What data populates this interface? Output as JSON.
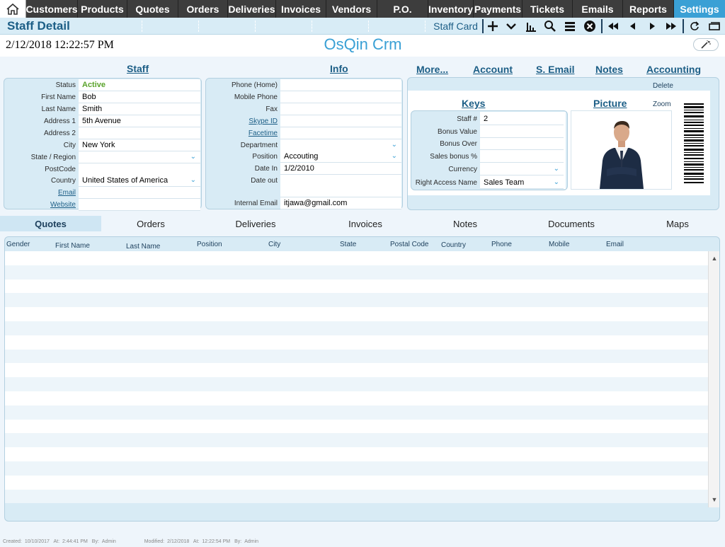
{
  "nav": {
    "home_icon": "home-icon",
    "items": [
      "Customers",
      "Products",
      "Quotes",
      "Orders",
      "Deliveries",
      "Invoices",
      "Vendors",
      "P.O.",
      "Inventory",
      "Payments",
      "Tickets",
      "Emails",
      "Reports",
      "Settings"
    ],
    "active": "Settings"
  },
  "toolbar": {
    "page_title": "Staff Detail",
    "staff_card_label": "Staff Card",
    "icons": [
      "add-icon",
      "chevron-down-icon",
      "chart-icon",
      "search-icon",
      "list-icon",
      "close-circle-icon",
      "first-record-icon",
      "previous-record-icon",
      "next-record-icon",
      "last-record-icon",
      "refresh-icon",
      "window-icon"
    ]
  },
  "header": {
    "datetime": "2/12/2018 12:22:57 PM",
    "app_title": "OsQin Crm",
    "magic_icon": "magic-wand-icon"
  },
  "sections": {
    "staff": "Staff",
    "info": "Info",
    "more": "More...",
    "account": "Account",
    "s_email": "S. Email",
    "notes": "Notes",
    "accounting": "Accounting"
  },
  "staff": {
    "status_label": "Status",
    "status": "Active",
    "first_name_label": "First Name",
    "first_name": "Bob",
    "last_name_label": "Last Name",
    "last_name": "Smith",
    "address1_label": "Address 1",
    "address1": "5th Avenue",
    "address2_label": "Address 2",
    "address2": "",
    "city_label": "City",
    "city": "New York",
    "state_label": "State / Region",
    "state": "",
    "postcode_label": "PostCode",
    "postcode": "",
    "country_label": "Country",
    "country": "United States of America",
    "email_label": "Email",
    "email": "",
    "website_label": "Website",
    "website": ""
  },
  "info": {
    "phone_home_label": "Phone (Home)",
    "phone_home": "",
    "mobile_label": "Mobile Phone",
    "mobile": "",
    "fax_label": "Fax",
    "fax": "",
    "skype_label": "Skype ID",
    "skype": "",
    "facetime_label": "Facetime",
    "facetime": "",
    "department_label": "Department",
    "department": "",
    "position_label": "Position",
    "position": "Accouting",
    "date_in_label": "Date In",
    "date_in": "1/2/2010",
    "date_out_label": "Date out",
    "date_out": "",
    "internal_email_label": "Internal Email",
    "internal_email": "itjawa@gmail.com"
  },
  "right_panel": {
    "delete_label": "Delete",
    "keys_title": "Keys",
    "picture_title": "Picture",
    "zoom_label": "Zoom",
    "staff_no_label": "Staff #",
    "staff_no": "2",
    "bonus_value_label": "Bonus Value",
    "bonus_value": "",
    "bonus_over_label": "Bonus Over",
    "bonus_over": "",
    "sales_bonus_label": "Sales bonus %",
    "sales_bonus": "",
    "currency_label": "Currency",
    "currency": "",
    "right_access_label": "Right Access Name",
    "right_access": "Sales Team"
  },
  "tabs": [
    "Quotes",
    "Orders",
    "Deliveries",
    "Invoices",
    "Notes",
    "Documents",
    "Maps"
  ],
  "grid": {
    "columns": [
      "Gender",
      "First Name",
      "Last Name",
      "Position",
      "City",
      "State",
      "Postal Code",
      "Country",
      "Phone",
      "Mobile",
      "Email"
    ]
  },
  "footer": {
    "created_label": "Created:",
    "created_date": "10/10/2017",
    "created_at_label": "At:",
    "created_time": "2:44:41 PM",
    "created_by_label": "By:",
    "created_by": "Admin",
    "modified_label": "Modified:",
    "modified_date": "2/12/2018",
    "modified_at_label": "At:",
    "modified_time": "12:22:54 PM",
    "modified_by_label": "By:",
    "modified_by": "Admin"
  },
  "colors": {
    "nav_bg": "#3d3d3d",
    "nav_active": "#3aa0d5",
    "accent": "#1c5e86",
    "panel_bg": "#d8ebf5",
    "status_active": "#5aa32a"
  }
}
